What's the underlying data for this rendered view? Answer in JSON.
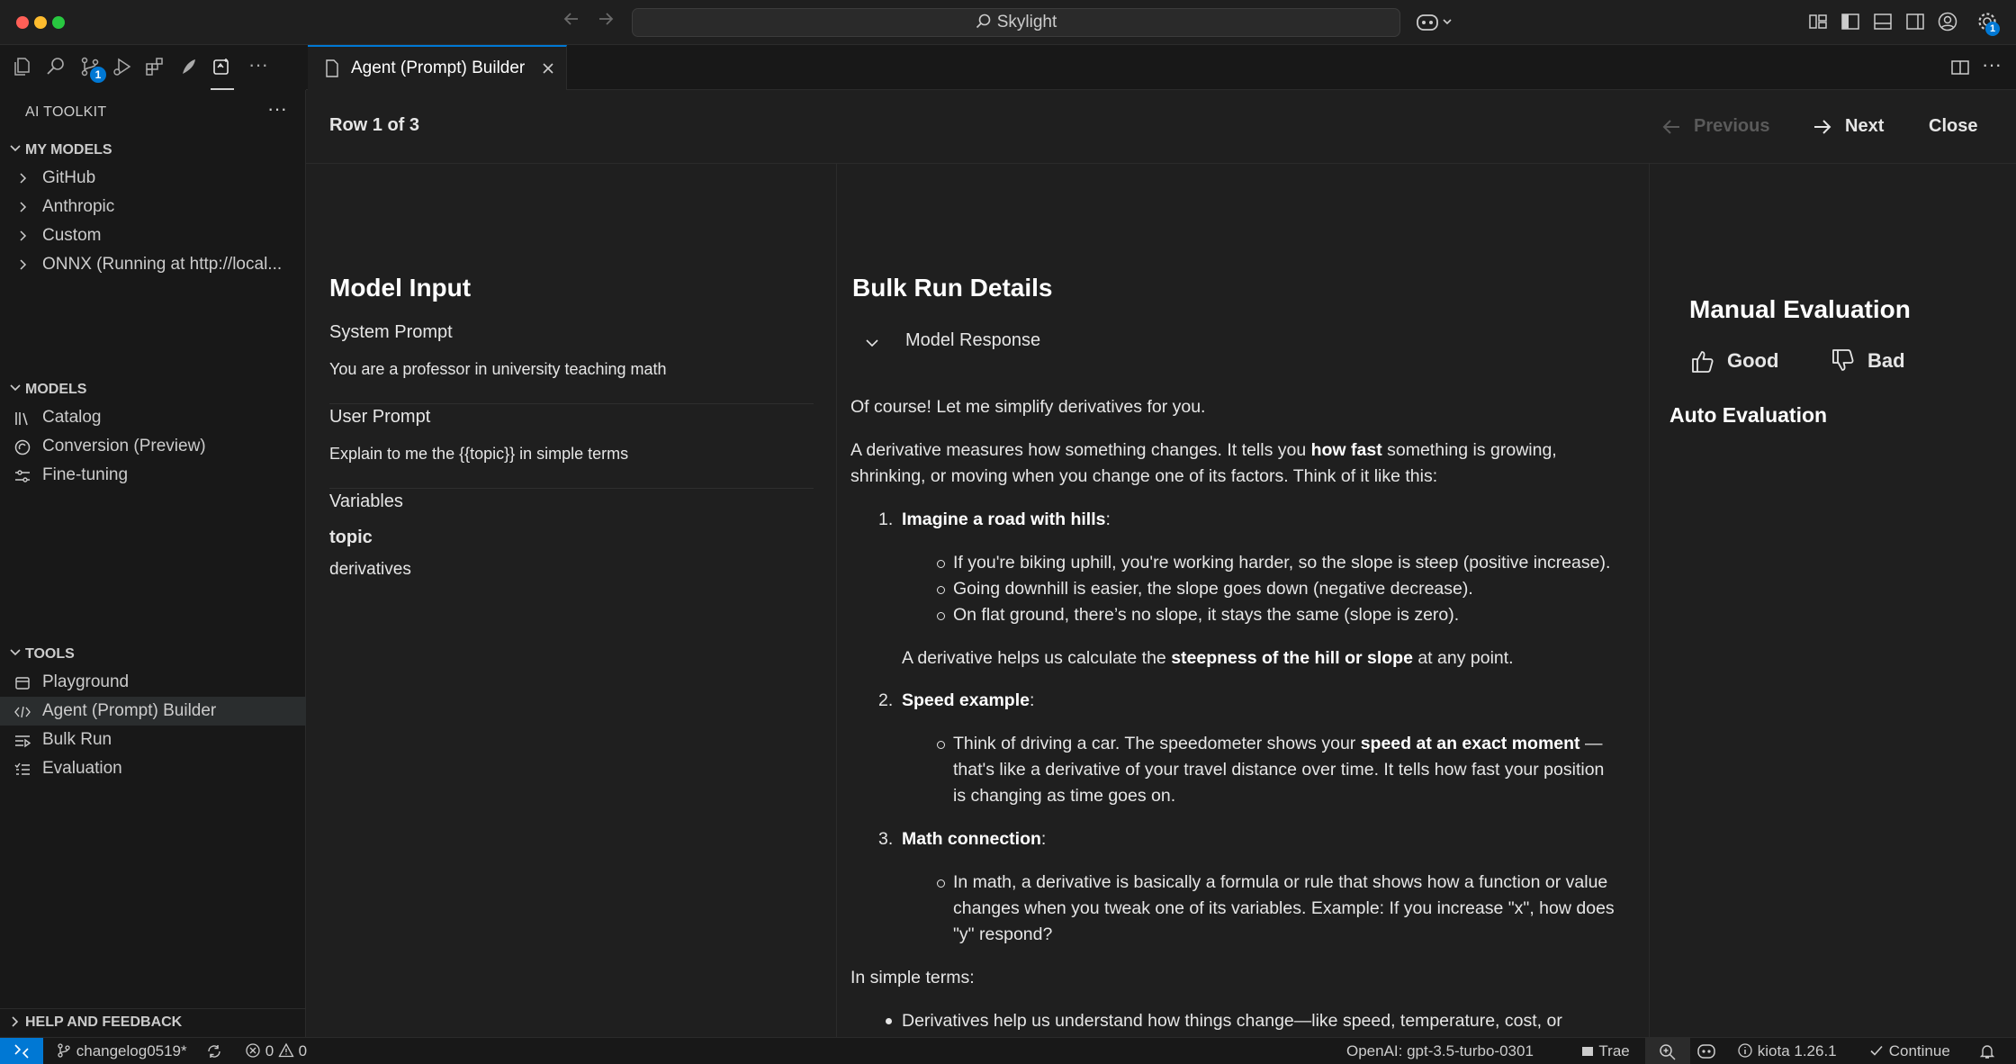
{
  "window": {
    "search_text": "Skylight"
  },
  "activity_bar": {
    "source_control_badge": "1",
    "accounts_badge": "1",
    "more": "···"
  },
  "sidebar": {
    "title": "AI TOOLKIT",
    "more": "···",
    "my_models": {
      "heading": "MY MODELS",
      "items": [
        {
          "label": "GitHub"
        },
        {
          "label": "Anthropic"
        },
        {
          "label": "Custom"
        },
        {
          "label": "ONNX (Running at http://local..."
        }
      ]
    },
    "models": {
      "heading": "MODELS",
      "items": [
        {
          "label": "Catalog",
          "icon": "library-icon"
        },
        {
          "label": "Conversion (Preview)",
          "icon": "conversion-icon"
        },
        {
          "label": "Fine-tuning",
          "icon": "settings-sliders-icon"
        }
      ]
    },
    "tools": {
      "heading": "TOOLS",
      "items": [
        {
          "label": "Playground",
          "icon": "playground-icon"
        },
        {
          "label": "Agent (Prompt) Builder",
          "icon": "agent-builder-icon",
          "selected": true
        },
        {
          "label": "Bulk Run",
          "icon": "bulk-run-icon"
        },
        {
          "label": "Evaluation",
          "icon": "evaluation-icon"
        }
      ]
    },
    "help": {
      "heading": "HELP AND FEEDBACK"
    }
  },
  "editor": {
    "tab_label": "Agent (Prompt) Builder",
    "row_label": "Row 1 of 3",
    "previous_label": "Previous",
    "next_label": "Next",
    "close_label": "Close",
    "model_input": {
      "title": "Model Input",
      "system_prompt_label": "System Prompt",
      "system_prompt_value": "You are a professor in university teaching math",
      "user_prompt_label": "User Prompt",
      "user_prompt_value": "Explain to me the {{topic}} in simple terms",
      "variables_label": "Variables",
      "variable_name": "topic",
      "variable_value": "derivatives"
    },
    "bulk_run": {
      "title": "Bulk Run Details",
      "model_response_label": "Model Response",
      "response": {
        "intro": "Of course! Let me simplify derivatives for you.",
        "p1_a": "A derivative measures how something changes. It tells you ",
        "p1_b": "how fast",
        "p1_c": " something is growing, shrinking, or moving when you change one of its factors. Think of it like this:",
        "item1_title": "Imagine a road with hills",
        "item1_b1": "If you're biking uphill, you're working harder, so the slope is steep (positive increase).",
        "item1_b2": "Going downhill is easier, the slope goes down (negative decrease).",
        "item1_b3": "On flat ground, there’s no slope, it stays the same (slope is zero).",
        "item1_p_a": "A derivative helps us calculate the ",
        "item1_p_b": "steepness of the hill or slope",
        "item1_p_c": " at any point.",
        "item2_title": "Speed example",
        "item2_b1_a": "Think of driving a car. The speedometer shows your ",
        "item2_b1_b": "speed at an exact moment",
        "item2_b1_c": " — that's like a derivative of your travel distance over time. It tells how fast your position is changing as time goes on.",
        "item3_title": "Math connection",
        "item3_b1": "In math, a derivative is basically a formula or rule that shows how a function or value changes when you tweak one of its variables. Example: If you increase \"x\", how does \"y\" respond?",
        "simple_terms": "In simple terms:",
        "simple_b1": "Derivatives help us understand how things change—like speed, temperature, cost, or anything dependent on another variable over time or space."
      }
    },
    "evaluation": {
      "manual_title": "Manual Evaluation",
      "good_label": "Good",
      "bad_label": "Bad",
      "auto_title": "Auto Evaluation"
    }
  },
  "statusbar": {
    "branch": "changelog0519*",
    "errors": "0",
    "warnings": "0",
    "model": "OpenAI: gpt-3.5-turbo-0301",
    "trae": "Trae",
    "kiota": "kiota 1.26.1",
    "continue": "Continue"
  },
  "colors": {
    "accent": "#0078d4",
    "background": "#1f1f1f",
    "sidebar": "#181818"
  }
}
